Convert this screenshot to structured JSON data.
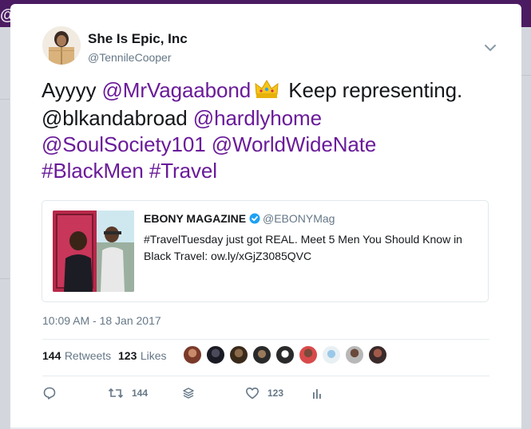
{
  "header_glyph": "@",
  "tweet": {
    "author_name": "She Is Epic, Inc",
    "author_handle": "@TennileCooper",
    "text_parts": {
      "p1": "Ayyyy ",
      "m1": "@MrVagaabond",
      "p2": " Keep representing. @blkandabroad ",
      "m2": "@hardlyhome",
      "m3": "@SoulSociety101",
      "m4": "@WorldWideNate",
      "h1": "#BlackMen",
      "h2": "#Travel"
    },
    "emoji": "crown-emoji",
    "timestamp": "10:09 AM - 18 Jan 2017"
  },
  "quote": {
    "name": "EBONY MAGAZINE",
    "handle": "@EBONYMag",
    "text": "#TravelTuesday just got REAL. Meet 5 Men You Should Know in Black Travel: ow.ly/xGjZ3085QVC"
  },
  "stats": {
    "retweets_count": "144",
    "retweets_label": "Retweets",
    "likes_count": "123",
    "likes_label": "Likes"
  },
  "actions": {
    "reply_icon": "reply-icon",
    "retweet_icon": "retweet-icon",
    "retweet_count": "144",
    "stack_icon": "stack-icon",
    "like_icon": "heart-icon",
    "like_count": "123",
    "analytics_icon": "analytics-icon"
  },
  "colors": {
    "topbar": "#4b1b62",
    "link": "#6a1b9a",
    "verified": "#1da1f2",
    "muted": "#657786"
  }
}
